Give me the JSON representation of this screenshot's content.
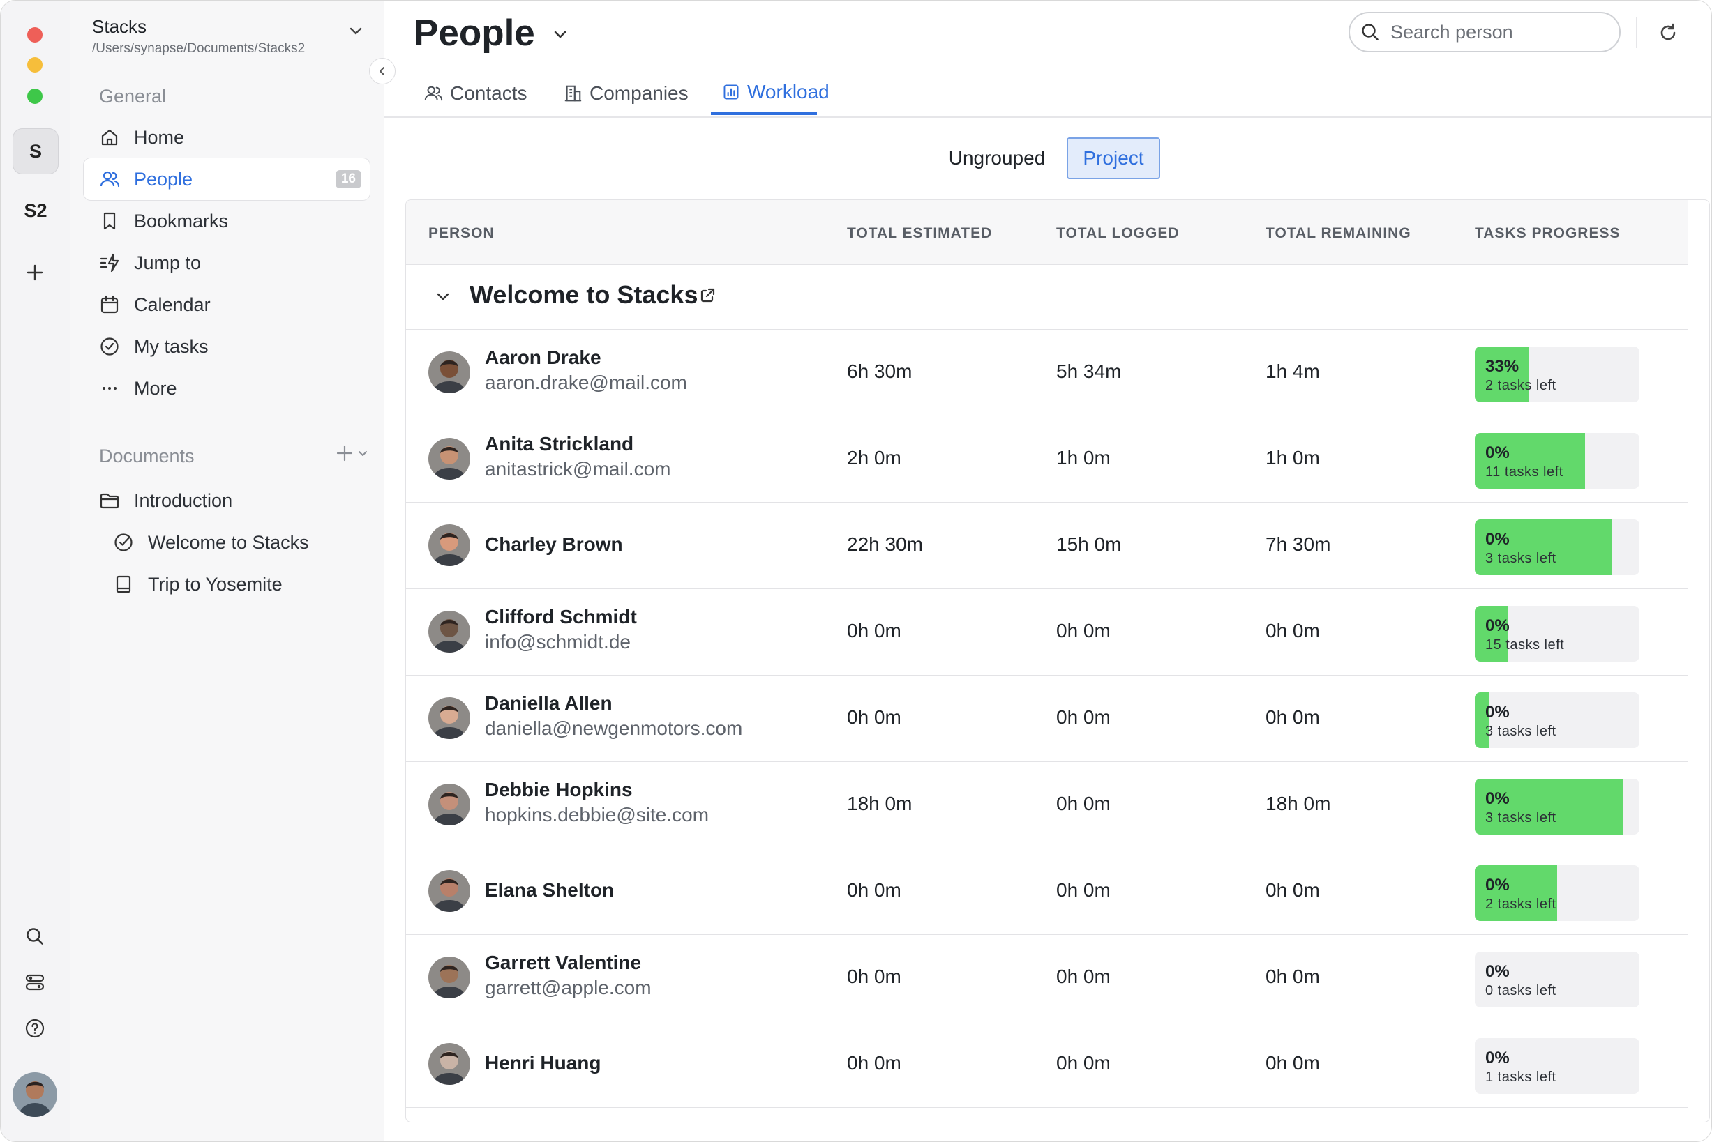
{
  "window": {
    "traffic_lights": {
      "close": "#ee5f58",
      "minimize": "#f6be3b",
      "zoom": "#3ec749"
    }
  },
  "rail": {
    "workspaces": [
      {
        "label": "S",
        "active": true
      },
      {
        "label": "S2",
        "active": false
      }
    ],
    "add_icon": "plus-icon",
    "bottom_icons": [
      "search-icon",
      "toggles-icon",
      "help-icon"
    ]
  },
  "sidebar": {
    "workspace_name": "Stacks",
    "workspace_path": "/Users/synapse/Documents/Stacks2",
    "general_title": "General",
    "items": [
      {
        "label": "Home",
        "icon": "home-icon"
      },
      {
        "label": "People",
        "icon": "people-icon",
        "badge": "16",
        "active": true
      },
      {
        "label": "Bookmarks",
        "icon": "bookmark-icon"
      },
      {
        "label": "Jump to",
        "icon": "jump-icon"
      },
      {
        "label": "Calendar",
        "icon": "calendar-icon"
      },
      {
        "label": "My tasks",
        "icon": "check-circle-icon"
      },
      {
        "label": "More",
        "icon": "ellipsis-icon"
      }
    ],
    "documents_title": "Documents",
    "documents": [
      {
        "label": "Introduction",
        "icon": "folder-icon"
      },
      {
        "label": "Welcome to Stacks",
        "icon": "check-circle-icon"
      },
      {
        "label": "Trip to Yosemite",
        "icon": "book-icon"
      }
    ]
  },
  "header": {
    "title": "People",
    "search_placeholder": "Search person",
    "tabs": [
      {
        "label": "Contacts",
        "icon": "contacts-icon"
      },
      {
        "label": "Companies",
        "icon": "building-icon"
      },
      {
        "label": "Workload",
        "icon": "chart-icon",
        "active": true
      }
    ]
  },
  "grouping": {
    "options": [
      "Ungrouped",
      "Project"
    ],
    "selected": "Project"
  },
  "table": {
    "columns": [
      "PERSON",
      "TOTAL ESTIMATED",
      "TOTAL LOGGED",
      "TOTAL REMAINING",
      "TASKS PROGRESS"
    ],
    "group": "Welcome to Stacks",
    "rows": [
      {
        "name": "Aaron Drake",
        "email": "aaron.drake@mail.com",
        "estimated": "6h 30m",
        "logged": "5h 34m",
        "remaining": "1h 4m",
        "pct": "33%",
        "left": "2 tasks left",
        "fill": 0.33,
        "skin": "#7a5038"
      },
      {
        "name": "Anita Strickland",
        "email": "anitastrick@mail.com",
        "estimated": "2h 0m",
        "logged": "1h 0m",
        "remaining": "1h 0m",
        "pct": "0%",
        "left": "11 tasks left",
        "fill": 0.67,
        "skin": "#c79274"
      },
      {
        "name": "Charley Brown",
        "email": "",
        "estimated": "22h 30m",
        "logged": "15h 0m",
        "remaining": "7h 30m",
        "pct": "0%",
        "left": "3 tasks left",
        "fill": 0.83,
        "skin": "#d89a7c"
      },
      {
        "name": "Clifford Schmidt",
        "email": "info@schmidt.de",
        "estimated": "0h 0m",
        "logged": "0h 0m",
        "remaining": "0h 0m",
        "pct": "0%",
        "left": "15 tasks left",
        "fill": 0.2,
        "skin": "#6d5545"
      },
      {
        "name": "Daniella Allen",
        "email": "daniella@newgenmotors.com",
        "estimated": "0h 0m",
        "logged": "0h 0m",
        "remaining": "0h 0m",
        "pct": "0%",
        "left": "3 tasks left",
        "fill": 0.09,
        "skin": "#d8ab92"
      },
      {
        "name": "Debbie Hopkins",
        "email": "hopkins.debbie@site.com",
        "estimated": "18h 0m",
        "logged": "0h 0m",
        "remaining": "18h 0m",
        "pct": "0%",
        "left": "3 tasks left",
        "fill": 0.9,
        "skin": "#c4907a"
      },
      {
        "name": "Elana Shelton",
        "email": "",
        "estimated": "0h 0m",
        "logged": "0h 0m",
        "remaining": "0h 0m",
        "pct": "0%",
        "left": "2 tasks left",
        "fill": 0.5,
        "skin": "#b8806a"
      },
      {
        "name": "Garrett Valentine",
        "email": "garrett@apple.com",
        "estimated": "0h 0m",
        "logged": "0h 0m",
        "remaining": "0h 0m",
        "pct": "0%",
        "left": "0 tasks left",
        "fill": 0,
        "skin": "#9c7358"
      },
      {
        "name": "Henri Huang",
        "email": "",
        "estimated": "0h 0m",
        "logged": "0h 0m",
        "remaining": "0h 0m",
        "pct": "0%",
        "left": "1 tasks left",
        "fill": 0,
        "skin": "#c9b3a6"
      }
    ]
  },
  "colors": {
    "accent": "#2f6fde",
    "progress": "#62d96b"
  }
}
